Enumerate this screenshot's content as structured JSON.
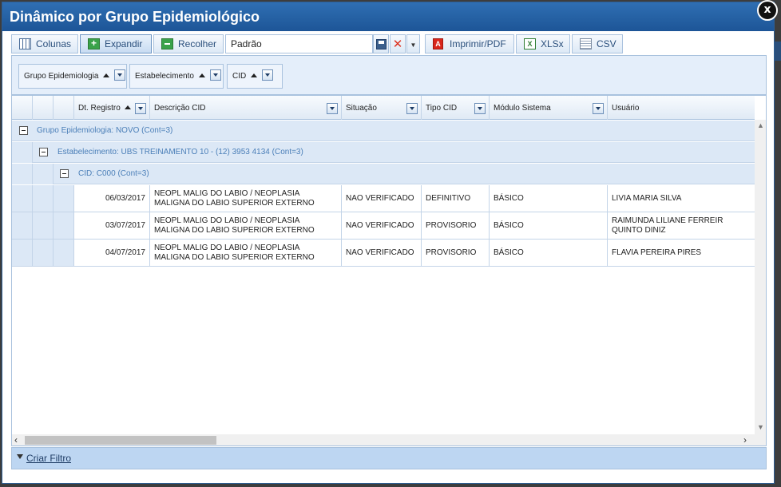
{
  "dialog": {
    "title": "Dinâmico por Grupo Epidemiológico",
    "close_label": "x"
  },
  "toolbar": {
    "columns_label": "Colunas",
    "expand_label": "Expandir",
    "collapse_label": "Recolher",
    "layout_value": "Padrão",
    "pdf_label": "Imprimir/PDF",
    "xlsx_label": "XLSx",
    "csv_label": "CSV"
  },
  "group_panel": {
    "chips": [
      "Grupo Epidemiologia",
      "Estabelecimento",
      "CID"
    ]
  },
  "grid": {
    "headers": [
      "Dt. Registro",
      "Descrição CID",
      "Situação",
      "Tipo CID",
      "Módulo Sistema",
      "Usuário"
    ],
    "group_level1": "Grupo Epidemiologia: NOVO (Cont=3)",
    "group_level2": "Estabelecimento: UBS TREINAMENTO 10 - (12) 3953 4134 (Cont=3)",
    "group_level3": "CID: C000 (Cont=3)",
    "rows": [
      [
        "06/03/2017",
        "NEOPL MALIG DO LABIO / NEOPLASIA MALIGNA DO LABIO SUPERIOR EXTERNO",
        "NAO VERIFICADO",
        "DEFINITIVO",
        "BÁSICO",
        "LIVIA MARIA SILVA"
      ],
      [
        "03/07/2017",
        "NEOPL MALIG DO LABIO / NEOPLASIA MALIGNA DO LABIO SUPERIOR EXTERNO",
        "NAO VERIFICADO",
        "PROVISORIO",
        "BÁSICO",
        "RAIMUNDA LILIANE FERREIR QUINTO DINIZ"
      ],
      [
        "04/07/2017",
        "NEOPL MALIG DO LABIO / NEOPLASIA MALIGNA DO LABIO SUPERIOR EXTERNO",
        "NAO VERIFICADO",
        "PROVISORIO",
        "BÁSICO",
        "FLAVIA PEREIRA PIRES"
      ]
    ]
  },
  "footer": {
    "create_filter_label": "Criar Filtro"
  }
}
